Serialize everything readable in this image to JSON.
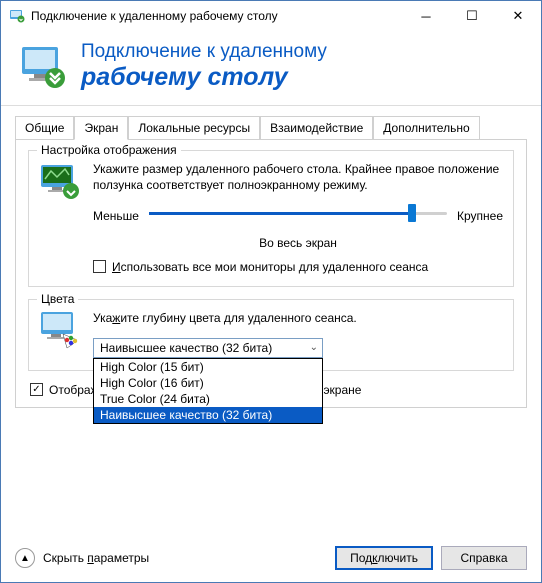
{
  "titlebar": {
    "text": "Подключение к удаленному рабочему столу"
  },
  "header": {
    "line1": "Подключение к удаленному",
    "line2": "рабочему столу"
  },
  "tabs": {
    "general": "Общие",
    "screen": "Экран",
    "local_resources": "Локальные ресурсы",
    "experience": "Взаимодействие",
    "advanced": "Дополнительно"
  },
  "display_group": {
    "title": "Настройка отображения",
    "description": "Укажите размер удаленного рабочего стола. Крайнее правое положение ползунка соответствует полноэкранному режиму.",
    "slider_min": "Меньше",
    "slider_max": "Крупнее",
    "slider_value": "Во весь экран",
    "use_all_monitors_prefix": "И",
    "use_all_monitors": "спользовать все мои мониторы для удаленного сеанса"
  },
  "colors_group": {
    "title": "Цвета",
    "description_prefix": "Ука",
    "description_u": "ж",
    "description_suffix": "ите глубину цвета для удаленного сеанса.",
    "selected": "Наивысшее качество (32 бита)",
    "options": [
      "High Color (15 бит)",
      "High Color (16 бит)",
      "True Color (24 бита)",
      "Наивысшее качество (32 бита)"
    ]
  },
  "connection_bar": {
    "label_prefix": "Отобража",
    "label_suffix": "е на полном экране"
  },
  "footer": {
    "hide_params_prefix": "Скрыть ",
    "hide_params_u": "п",
    "hide_params_suffix": "араметры",
    "connect_prefix": "Под",
    "connect_u": "к",
    "connect_suffix": "лючить",
    "help": "Справка"
  }
}
